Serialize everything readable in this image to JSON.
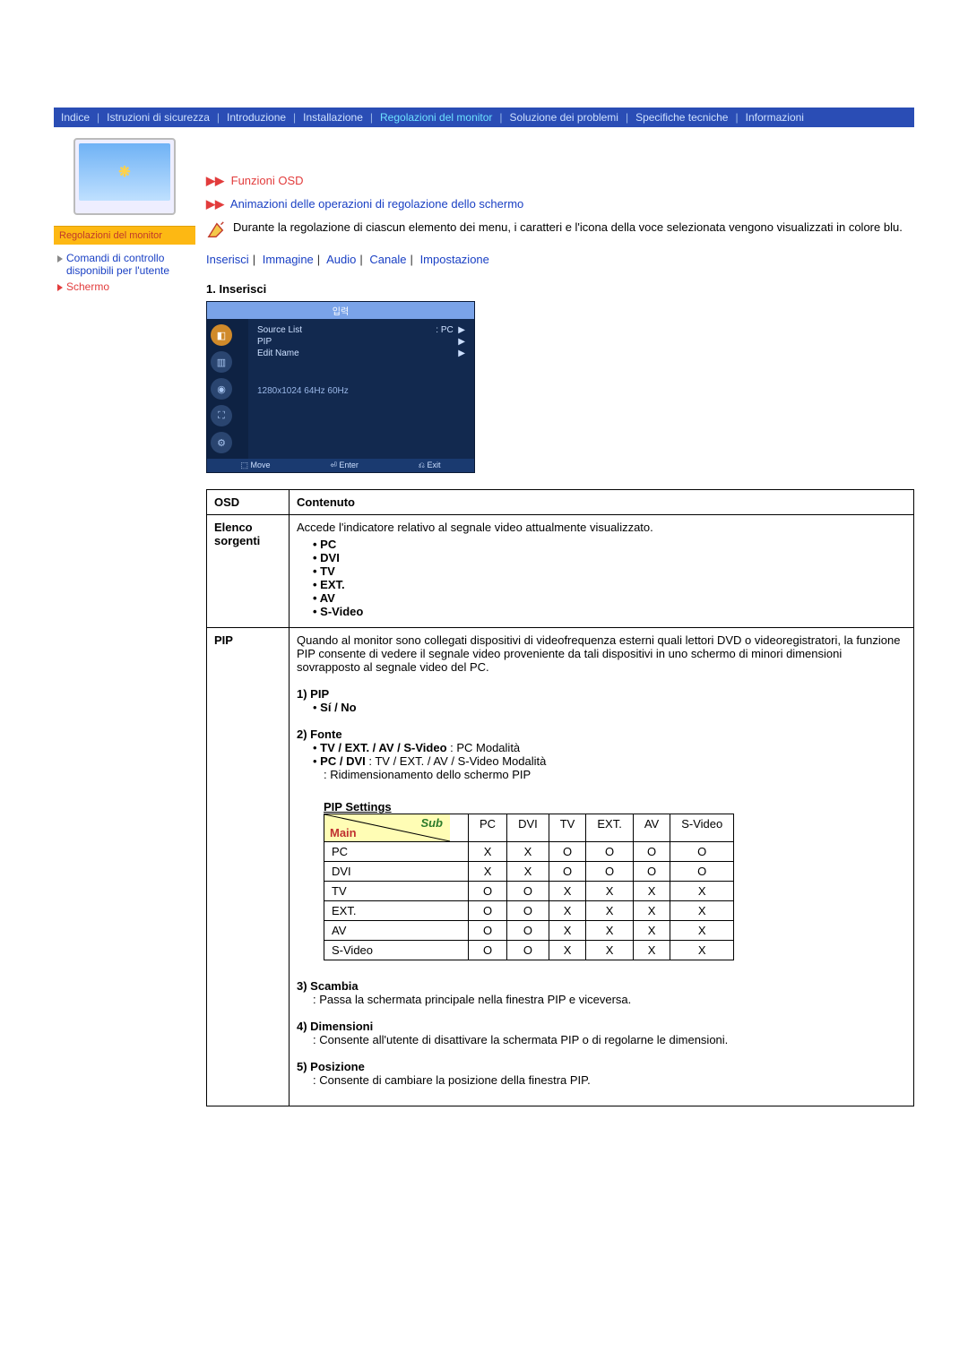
{
  "nav": {
    "items": [
      "Indice",
      "Istruzioni di sicurezza",
      "Introduzione",
      "Installazione",
      "Regolazioni del monitor",
      "Soluzione dei problemi",
      "Specifiche tecniche",
      "Informazioni"
    ],
    "activeIndex": 4
  },
  "sidebar": {
    "title": "Regolazioni del monitor",
    "monitorText": "❋",
    "links": [
      {
        "label": "Comandi di controllo disponibili per l'utente",
        "active": false
      },
      {
        "label": "Schermo",
        "active": true
      }
    ]
  },
  "topLinks": {
    "funzioni": "Funzioni OSD",
    "animazioni": "Animazioni delle operazioni di regolazione dello schermo"
  },
  "infoText": "Durante la regolazione di ciascun elemento dei menu, i caratteri e l'icona della voce selezionata vengono visualizzati in colore blu.",
  "tabs": [
    "Inserisci",
    "Immagine",
    "Audio",
    "Canale",
    "Impostazione"
  ],
  "section1": {
    "heading": "1. Inserisci"
  },
  "osdShot": {
    "title": "입력",
    "items": [
      {
        "label": "Source List",
        "value": ": PC",
        "arrow": "▶"
      },
      {
        "label": "PIP",
        "value": "",
        "arrow": "▶"
      },
      {
        "label": "Edit Name",
        "value": "",
        "arrow": "▶"
      }
    ],
    "resolution": "1280x1024    64Hz        60Hz",
    "footer": [
      "⬚ Move",
      "⏎ Enter",
      "⎌ Exit"
    ]
  },
  "osdTable": {
    "headers": [
      "OSD",
      "Contenuto"
    ],
    "row1": {
      "osd": "Elenco sorgenti",
      "intro": "Accede l'indicatore relativo al segnale video attualmente visualizzato.",
      "bullets": [
        "PC",
        "DVI",
        "TV",
        "EXT.",
        "AV",
        "S-Video"
      ]
    },
    "row2": {
      "osd": "PIP",
      "intro": "Quando al monitor sono collegati dispositivi di videofrequenza esterni quali lettori DVD o videoregistratori, la funzione PIP consente di vedere il segnale video proveniente da tali dispositivi in uno schermo di minori dimensioni sovrapposto al segnale video del PC.",
      "p1label": "1) PIP",
      "p1bullet": "Sí / No",
      "p2label": "2) Fonte",
      "p2line1b": "TV / EXT. / AV / S-Video",
      "p2line1t": " : PC Modalità",
      "p2line2b": "PC / DVI",
      "p2line2t": " : TV / EXT. / AV / S-Video Modalità",
      "p2line3": ": Ridimensionamento dello schermo PIP",
      "pipSettingsTitle": "PIP Settings",
      "p3label": "3) Scambia",
      "p3text": ": Passa la schermata principale nella finestra PIP e viceversa.",
      "p4label": "4) Dimensioni",
      "p4text": ": Consente all'utente di disattivare la schermata PIP o di regolarne le dimensioni.",
      "p5label": "5) Posizione",
      "p5text": ": Consente di cambiare la posizione della finestra PIP."
    }
  },
  "pipMatrix": {
    "cornerMain": "Main",
    "cornerSub": "Sub",
    "subHeaders": [
      "PC",
      "DVI",
      "TV",
      "EXT.",
      "AV",
      "S-Video"
    ],
    "rows": [
      {
        "main": "PC",
        "cells": [
          "X",
          "X",
          "O",
          "O",
          "O",
          "O"
        ]
      },
      {
        "main": "DVI",
        "cells": [
          "X",
          "X",
          "O",
          "O",
          "O",
          "O"
        ]
      },
      {
        "main": "TV",
        "cells": [
          "O",
          "O",
          "X",
          "X",
          "X",
          "X"
        ]
      },
      {
        "main": "EXT.",
        "cells": [
          "O",
          "O",
          "X",
          "X",
          "X",
          "X"
        ]
      },
      {
        "main": "AV",
        "cells": [
          "O",
          "O",
          "X",
          "X",
          "X",
          "X"
        ]
      },
      {
        "main": "S-Video",
        "cells": [
          "O",
          "O",
          "X",
          "X",
          "X",
          "X"
        ]
      }
    ]
  }
}
